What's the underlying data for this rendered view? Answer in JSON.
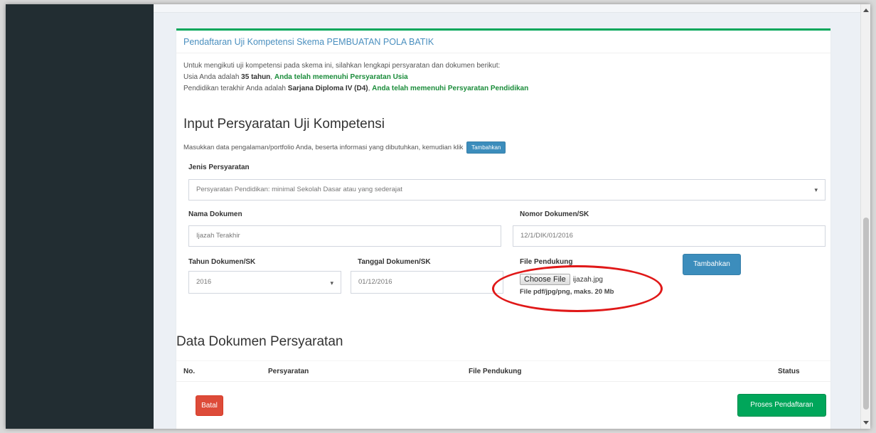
{
  "colors": {
    "sidebar": "#222d32",
    "accent_green": "#00a65a",
    "primary_blue": "#3c8dbc",
    "danger_red": "#dd4b39",
    "annotation_red": "#e01818"
  },
  "box": {
    "title": "Pendaftaran Uji Kompetensi Skema PEMBUATAN POLA BATIK"
  },
  "info": {
    "line1": "Untuk mengikuti uji kompetensi pada skema ini, silahkan lengkapi persyaratan dan dokumen berikut:",
    "age_prefix": "Usia Anda adalah ",
    "age_value": "35 tahun",
    "age_sep": ", ",
    "age_status": "Anda telah memenuhi Persyaratan Usia",
    "edu_prefix": "Pendidikan terakhir Anda adalah ",
    "edu_value": "Sarjana Diploma IV (D4)",
    "edu_sep": ", ",
    "edu_status": "Anda telah memenuhi Persyaratan Pendidikan"
  },
  "input_section": {
    "heading": "Input Persyaratan Uji Kompetensi",
    "instruction": "Masukkan data pengalaman/portfolio Anda, beserta informasi yang dibutuhkan, kemudian klik",
    "inline_button": "Tambahkan"
  },
  "form": {
    "jenis_label": "Jenis Persyaratan",
    "jenis_value": "Persyaratan Pendidikan: minimal Sekolah Dasar atau yang sederajat",
    "nama_label": "Nama Dokumen",
    "nama_placeholder": "Ijazah Terakhir",
    "nomor_label": "Nomor Dokumen/SK",
    "nomor_value": "12/1/DIK/01/2016",
    "tahun_label": "Tahun Dokumen/SK",
    "tahun_value": "2016",
    "tanggal_label": "Tanggal Dokumen/SK",
    "tanggal_value": "01/12/2016",
    "file_label": "File Pendukung",
    "choose_file_label": "Choose File",
    "file_name": "ijazah.jpg",
    "file_note": "File pdf/jpg/png, maks. 20 Mb",
    "add_button": "Tambahkan"
  },
  "table": {
    "heading": "Data Dokumen Persyaratan",
    "columns": [
      "No.",
      "Persyaratan",
      "File Pendukung",
      "Status"
    ]
  },
  "actions": {
    "cancel": "Batal",
    "submit": "Proses Pendaftaran"
  },
  "icons": {
    "select_caret": "chevron-down-icon",
    "scroll_up": "arrow-up-icon",
    "scroll_down": "arrow-down-icon"
  }
}
